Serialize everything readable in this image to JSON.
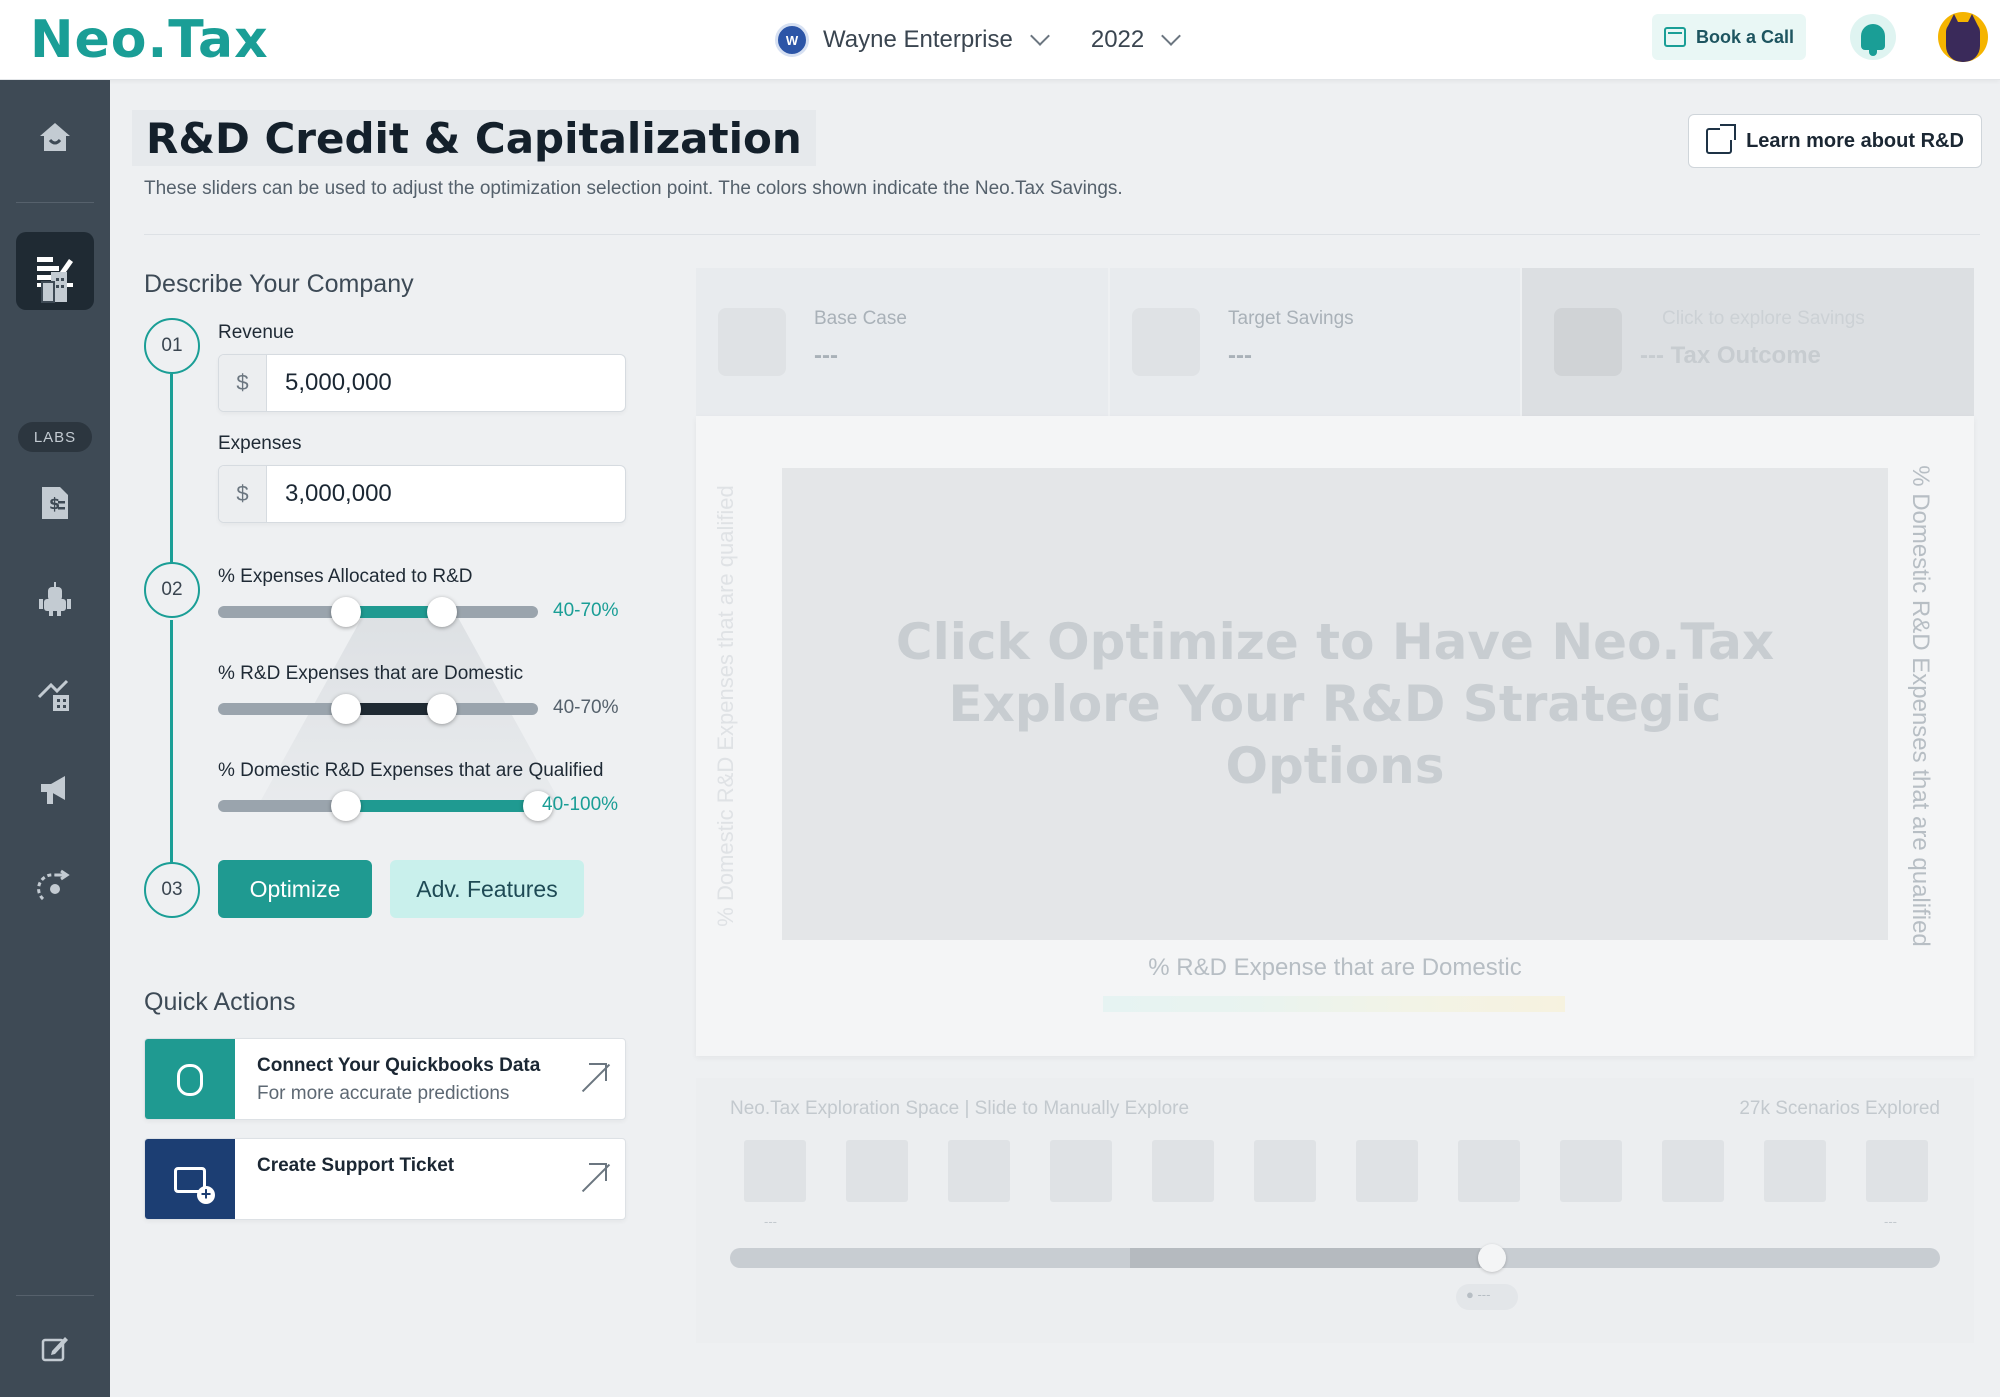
{
  "app": {
    "logo": "Neo.Tax",
    "company": "Wayne Enterprise",
    "company_badge": "W",
    "year": "2022",
    "book_call": "Book a Call",
    "brand_color": "#1a9e96"
  },
  "sidebar": {
    "labs_label": "LABS",
    "items": [
      "home-icon",
      "tax-credit-icon",
      "building-icon",
      "document-dollar-icon",
      "robot-icon",
      "growth-building-icon",
      "megaphone-icon",
      "process-icon",
      "edit-icon"
    ],
    "active": "tax-credit-icon"
  },
  "header": {
    "title": "R&D Credit & Capitalization",
    "subtitle": "These sliders can be used to adjust the optimization selection point. The colors shown indicate the Neo.Tax Savings.",
    "learn_more": "Learn more about R&D"
  },
  "form": {
    "section_title": "Describe Your Company",
    "steps": [
      "01",
      "02",
      "03"
    ],
    "revenue": {
      "label": "Revenue",
      "prefix": "$",
      "value": "5,000,000"
    },
    "expenses": {
      "label": "Expenses",
      "prefix": "$",
      "value": "3,000,000"
    },
    "sliders": [
      {
        "label": "% Expenses Allocated to R&D",
        "range_text": "40-70%",
        "low": 0.4,
        "high": 0.7,
        "min": 0,
        "max": 1,
        "fill": "#1f9a91",
        "text_color": "#1a9e96"
      },
      {
        "label": "% R&D Expenses that are Domestic",
        "range_text": "40-70%",
        "low": 0.4,
        "high": 0.7,
        "min": 0,
        "max": 1,
        "fill": "#1f2a33",
        "text_color": "#55616c"
      },
      {
        "label": "% Domestic R&D Expenses that are Qualified",
        "range_text": "40-100%",
        "low": 0.4,
        "high": 1.0,
        "min": 0,
        "max": 1,
        "fill": "#1f9a91",
        "text_color": "#1a9e96"
      }
    ],
    "optimize": "Optimize",
    "adv_features": "Adv. Features"
  },
  "quick_actions": {
    "title": "Quick Actions",
    "items": [
      {
        "title": "Connect Your Quickbooks Data",
        "subtitle": "For more accurate predictions",
        "icon": "link-icon",
        "color": "#1f9a91"
      },
      {
        "title": "Create Support Ticket",
        "subtitle": "",
        "icon": "ticket-add-icon",
        "color": "#1c3e73"
      }
    ]
  },
  "results": {
    "stats": [
      {
        "label": "Base Case",
        "value": "---"
      },
      {
        "label": "Target Savings",
        "value": "---"
      },
      {
        "label": "Click to explore Savings",
        "value": "--- Tax Outcome"
      }
    ],
    "chart_message_line1": "Click Optimize to Have Neo.Tax",
    "chart_message_line2": "Explore Your R&D Strategic Options",
    "y_left": "% Domestic R&D Expenses that are qualified",
    "y_right": "% Domestic R&D Expenses that are qualified",
    "x_label": "% R&D Expense that are Domestic",
    "explore_header": "Neo.Tax Exploration Space | Slide to Manually Explore",
    "scenarios": "27k Scenarios Explored",
    "tile_first_label": "---",
    "tile_last_label": "---",
    "pager": "● ---"
  }
}
